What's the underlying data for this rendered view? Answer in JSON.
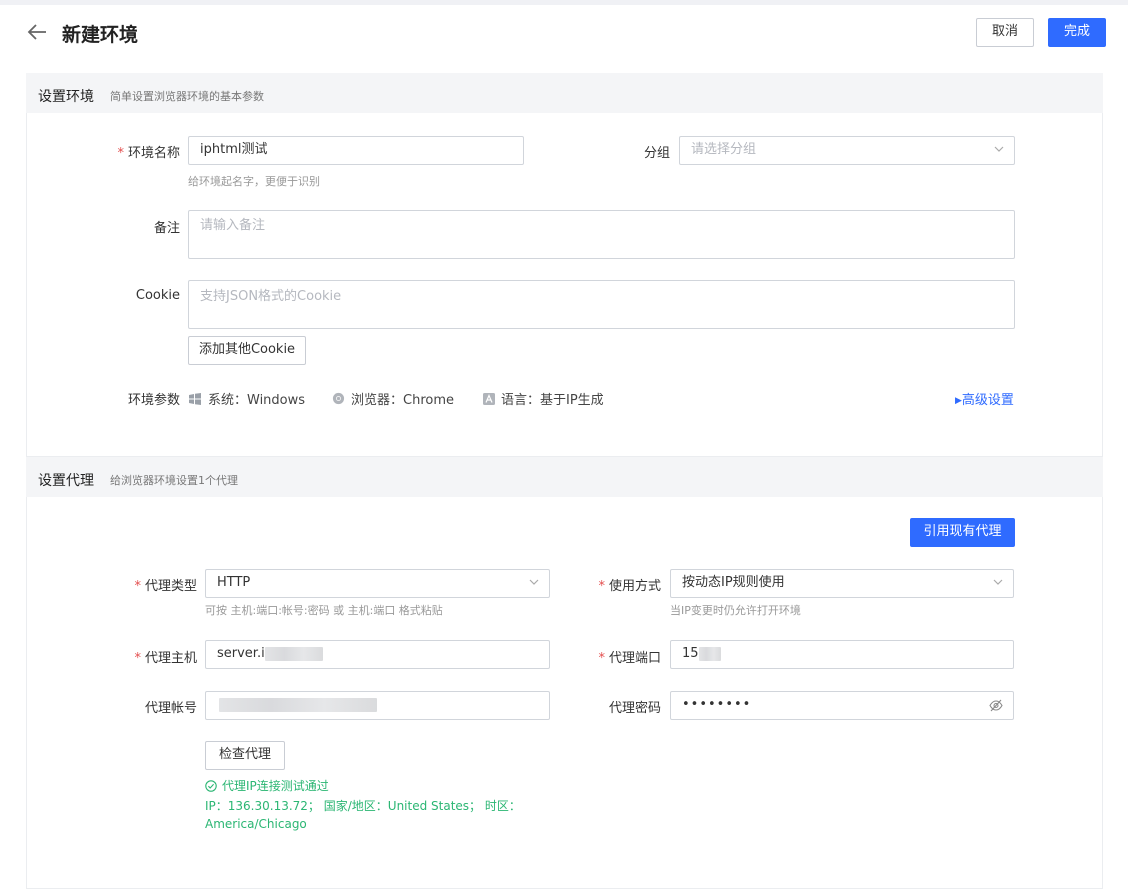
{
  "header": {
    "title": "新建环境",
    "cancel_label": "取消",
    "done_label": "完成"
  },
  "env_section": {
    "title": "设置环境",
    "subtitle": "简单设置浏览器环境的基本参数",
    "name": {
      "label": "环境名称",
      "value": "iphtml测试",
      "hint": "给环境起名字，更便于识别"
    },
    "group": {
      "label": "分组",
      "placeholder": "请选择分组"
    },
    "remark": {
      "label": "备注",
      "placeholder": "请输入备注"
    },
    "cookie": {
      "label": "Cookie",
      "placeholder": "支持JSON格式的Cookie",
      "add_label": "添加其他Cookie"
    },
    "params": {
      "label": "环境参数",
      "system": "系统：Windows",
      "browser": "浏览器：Chrome",
      "language": "语言：基于IP生成"
    },
    "advanced_label": "高级设置"
  },
  "proxy_section": {
    "title": "设置代理",
    "subtitle": "给浏览器环境设置1个代理",
    "use_existing_label": "引用现有代理",
    "type": {
      "label": "代理类型",
      "value": "HTTP",
      "hint": "可按 主机:端口:帐号:密码 或 主机:端口 格式粘贴"
    },
    "usage": {
      "label": "使用方式",
      "value": "按动态IP规则使用",
      "hint": "当IP变更时仍允许打开环境"
    },
    "host": {
      "label": "代理主机",
      "value": "server.i"
    },
    "port": {
      "label": "代理端口",
      "value": "15"
    },
    "account": {
      "label": "代理帐号"
    },
    "password": {
      "label": "代理密码",
      "value": "••••••••"
    },
    "check_label": "检查代理",
    "result": {
      "status": "代理IP连接测试通过",
      "detail_line1": "IP：136.30.13.72；  国家/地区：United States；  时区：",
      "detail_line2": "America/Chicago"
    }
  },
  "colors": {
    "primary": "#2f6bff",
    "required": "#e34d4d",
    "success": "#2bb673"
  }
}
